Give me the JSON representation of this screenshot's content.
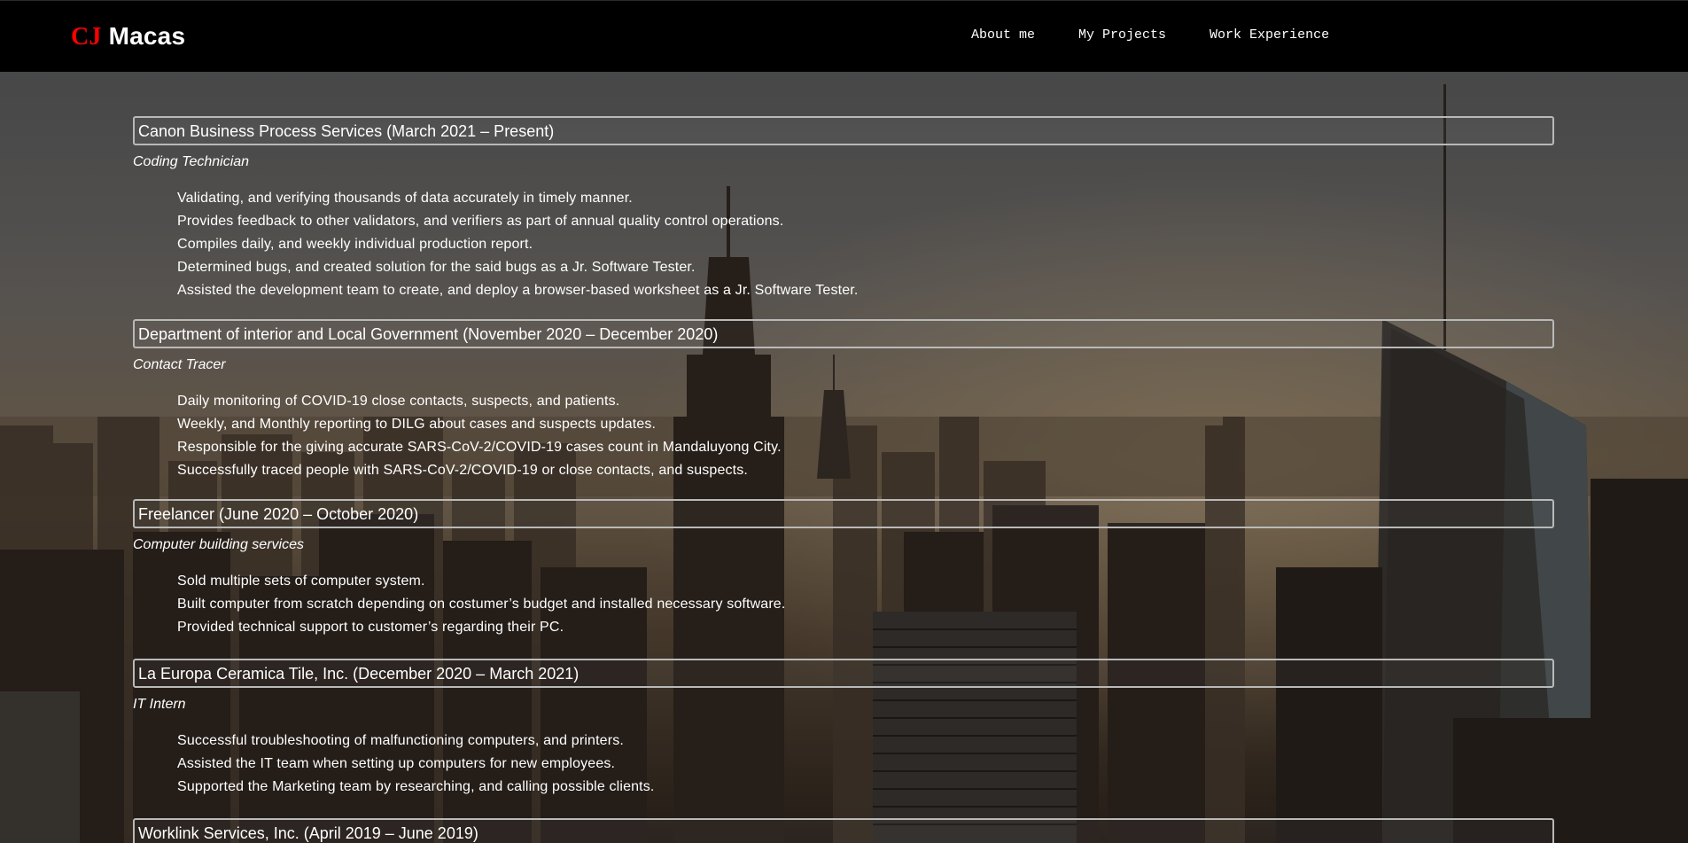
{
  "nav": {
    "logo_initials": "CJ",
    "logo_name": "Macas",
    "links": [
      "About me",
      "My Projects",
      "Work Experience"
    ]
  },
  "jobs": [
    {
      "header": "Canon Business Process Services (March 2021 – Present)",
      "role": "Coding Technician",
      "duties": [
        "Validating, and verifying thousands of data accurately in timely manner.",
        "Provides feedback to other validators, and verifiers as part of annual quality control operations.",
        "Compiles daily, and weekly individual production report.",
        "Determined bugs, and created solution for the said bugs as a Jr. Software Tester.",
        "Assisted the development team to create, and deploy a browser-based worksheet as a Jr. Software Tester."
      ]
    },
    {
      "header": "Department of interior and Local Government (November 2020 – December 2020)",
      "role": "Contact Tracer",
      "duties": [
        "Daily monitoring of COVID-19 close contacts, suspects, and patients.",
        "Weekly, and Monthly reporting to DILG about cases and suspects updates.",
        "Responsible for the giving accurate SARS-CoV-2/COVID-19 cases count in Mandaluyong City.",
        "Successfully traced people with SARS-CoV-2/COVID-19 or close contacts, and suspects."
      ]
    },
    {
      "header": "Freelancer (June 2020 – October 2020)",
      "role": "Computer building services",
      "duties": [
        "Sold multiple sets of computer system.",
        "Built computer from scratch depending on costumer’s budget and installed necessary software.",
        "Provided technical support to customer’s regarding their PC."
      ]
    },
    {
      "header": "La Europa Ceramica Tile, Inc. (December 2020 – March 2021)",
      "role": "IT Intern",
      "duties": [
        "Successful troubleshooting of malfunctioning computers, and printers.",
        "Assisted the IT team when setting up computers for new employees.",
        "Supported the Marketing team by researching, and calling possible clients."
      ]
    },
    {
      "header": "Worklink Services, Inc. (April 2019 – June 2019)",
      "role": "",
      "duties": []
    }
  ]
}
